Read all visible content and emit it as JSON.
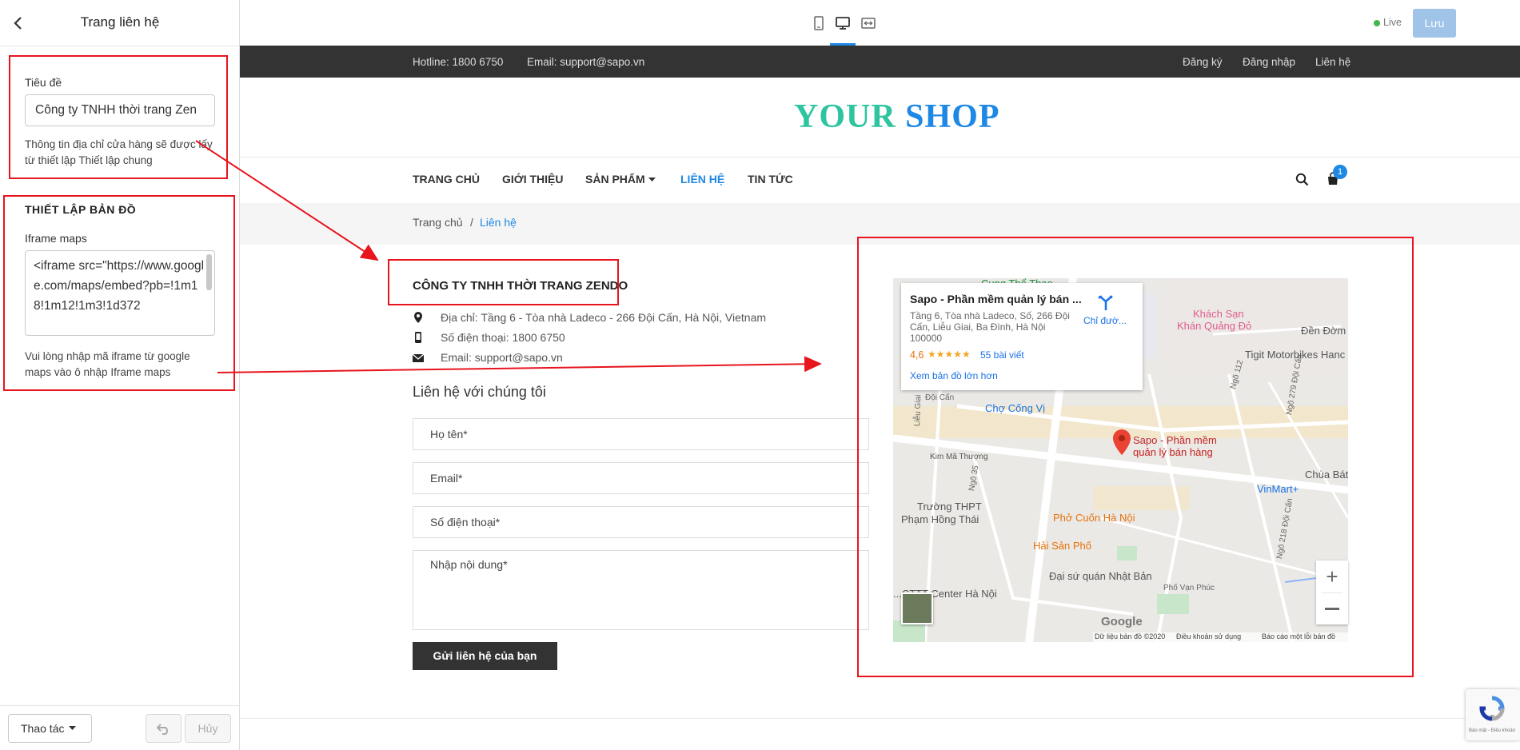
{
  "sidebar": {
    "title": "Trang liên hệ",
    "title_label": "Tiêu đề",
    "title_value": "Công ty TNHH thời trang Zen",
    "title_help_1": "Thông tin địa chỉ cửa hàng sẽ được lấy",
    "title_help_2": "từ thiết lập Thiết lập chung",
    "map_section": "THIẾT LẬP BẢN ĐỒ",
    "iframe_label": "Iframe maps",
    "iframe_value": "<iframe src=\"https://www.google.com/maps/embed?pb=!1m18!1m12!1m3!1d372",
    "iframe_help_1": "Vui lòng nhập mã iframe từ google",
    "iframe_help_2": "maps vào ô nhập Iframe maps",
    "actions_label": "Thao tác",
    "cancel_label": "Hủy"
  },
  "toolbar": {
    "live_label": "Live",
    "save_label": "Lưu",
    "status_color": "#45b649",
    "accent_color": "#1e88e5"
  },
  "preview": {
    "hotline": "Hotline: 1800 6750",
    "email": "Email: support@sapo.vn",
    "top_links": [
      "Đăng ký",
      "Đăng nhập",
      "Liên hệ"
    ],
    "logo_1": "YOUR",
    "logo_2": "SHOP",
    "logo_colors": [
      "#2ec4a0",
      "#1e88e5"
    ],
    "nav": [
      "TRANG CHỦ",
      "GIỚI THIỆU",
      "SẢN PHẨM",
      "LIÊN HỆ",
      "TIN TỨC"
    ],
    "cart_count": "1",
    "breadcrumb": [
      "Trang chủ",
      "/",
      "Liên hệ"
    ],
    "company": "CÔNG TY TNHH THỜI TRANG ZENDO",
    "address": "Địa chỉ: Tầng 6 - Tòa nhà Ladeco - 266 Đội Cấn, Hà Nội, Vietnam",
    "phone": "Số điện thoại: 1800 6750",
    "contact_email": "Email: support@sapo.vn",
    "contact_heading": "Liên hệ với chúng tôi",
    "form": {
      "name": "Họ tên*",
      "email": "Email*",
      "phone": "Số điện thoại*",
      "message": "Nhập nội dung*",
      "submit": "Gửi liên hệ của bạn"
    }
  },
  "map": {
    "card_title": "Sapo - Phần mềm quản lý bán ...",
    "card_addr_1": "Tầng 6, Tòa nhà Ladeco, Số, 266 Đội",
    "card_addr_2": "Cấn, Liễu Giai, Ba Đình, Hà Nội",
    "card_addr_3": "100000",
    "rating": "4,6",
    "stars": "★★★★★",
    "reviews": "55 bài viết",
    "larger_map": "Xem bản đồ lớn hơn",
    "directions": "Chỉ đườ...",
    "pin_1": "Sapo - Phần mềm",
    "pin_2": "quản lý bán hàng",
    "places": {
      "cung_the_thao": "Cung Thể Thao",
      "khach_san_1": "Khách Sạn",
      "khach_san_2": "Khán Quảng Đỏ",
      "den_don": "Đền Đờm",
      "tigit": "Tigit Motorbikes Hanc",
      "doi_can": "Đội Cấn",
      "cho_cong_vi": "Chợ Cống Vị",
      "lieu_giai": "Liễu Giai",
      "kim_ma_thuong": "Kim Mã Thượng",
      "truong_1": "Trường THPT",
      "truong_2": "Phạm Hồng Thái",
      "pho_cuon": "Phở Cuốn Hà Nội",
      "vinmart": "VinMart+",
      "chua_bat": "Chùa Bát",
      "hai_san": "Hải Sản Phố",
      "dai_su_quan": "Đại sứ quán Nhật Bản",
      "center": "...CTTT Center Hà Nội",
      "ngo_112": "Ngõ 112",
      "ngo_279": "Ngõ 279 Đội Cấn",
      "ngo_35": "Ngõ 35",
      "ngo_218": "Ngõ 218 Đội Cấn",
      "pho_van_phuc": "Phố Vạn Phúc"
    },
    "google": "Google",
    "attribution": "Dữ liệu bản đồ ©2020",
    "terms": "Điều khoản sử dụng",
    "report": "Báo cáo một lỗi bản đồ"
  },
  "recaptcha": "Bảo mật - Điều khoản"
}
